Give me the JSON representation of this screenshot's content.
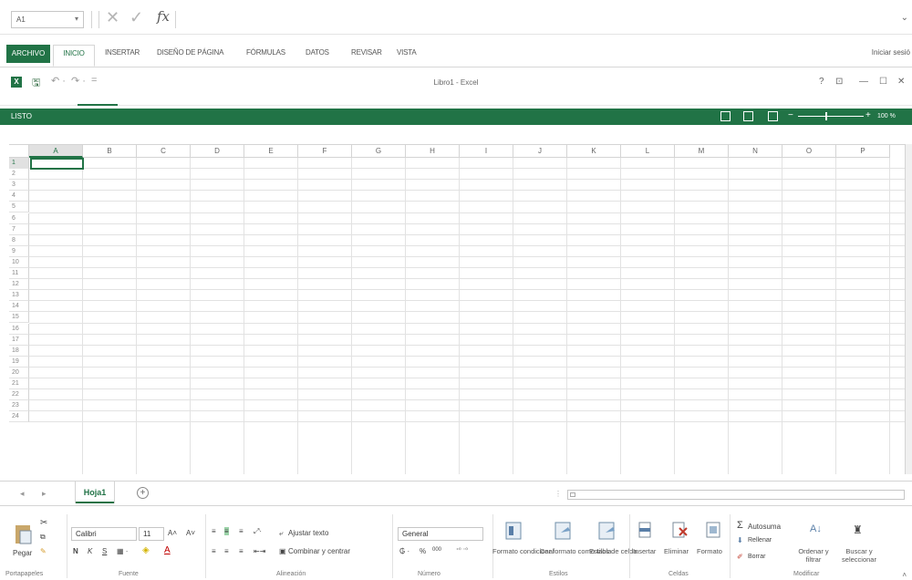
{
  "formula_bar": {
    "name_box": "A1",
    "fx": "fx",
    "cancel_symbol": "✕",
    "enter_symbol": "✓",
    "expand_symbol": "⌄",
    "formula": ""
  },
  "ribbon_tabs": [
    "ARCHIVO",
    "INICIO",
    "INSERTAR",
    "DISEÑO DE PÁGINA",
    "FÓRMULAS",
    "DATOS",
    "REVISAR",
    "VISTA"
  ],
  "signin": "Iniciar sesió",
  "window": {
    "title": "Libro1 - Excel",
    "help": "?",
    "restore": "⊡",
    "minimize": "—",
    "maximize": "☐",
    "close": "✕"
  },
  "status": {
    "ready": "LISTO",
    "zoom": "100 %"
  },
  "accent_color": "#217346",
  "grid": {
    "columns": [
      "A",
      "B",
      "C",
      "D",
      "E",
      "F",
      "G",
      "H",
      "I",
      "J",
      "K",
      "L",
      "M",
      "N",
      "O",
      "P"
    ],
    "rows": [
      "1",
      "2",
      "3",
      "4",
      "5",
      "6",
      "7",
      "8",
      "9",
      "10",
      "11",
      "12",
      "13",
      "14",
      "15",
      "16",
      "17",
      "18",
      "19",
      "20",
      "21",
      "22",
      "23",
      "24"
    ],
    "active_cell": "A1"
  },
  "sheets": {
    "tabs": [
      "Hoja1"
    ],
    "add": "⊕"
  },
  "ribbon": {
    "portapapeles": {
      "paste": "Pegar",
      "label": "Portapapeles"
    },
    "fuente": {
      "font": "Calibri",
      "size": "11",
      "bold": "N",
      "italic": "K",
      "underline": "S",
      "label": "Fuente"
    },
    "alineacion": {
      "wrap": "Ajustar texto",
      "merge": "Combinar y centrar",
      "label": "Alineación"
    },
    "numero": {
      "format": "General",
      "percent": "%",
      "thousands": "000",
      "label": "Número"
    },
    "estilos": {
      "cond_format": "Formato condicional",
      "table_format": "Dar formato como tabla",
      "cell_styles": "Estilos de celda",
      "label": "Estilos"
    },
    "celdas": {
      "insert": "Insertar",
      "delete": "Eliminar",
      "format": "Formato",
      "label": "Celdas"
    },
    "modificar": {
      "autosum": "Autosuma",
      "fill": "Rellenar",
      "clear": "Borrar",
      "sort": "Ordenar y filtrar",
      "find": "Buscar y seleccionar",
      "label": "Modificar"
    }
  }
}
